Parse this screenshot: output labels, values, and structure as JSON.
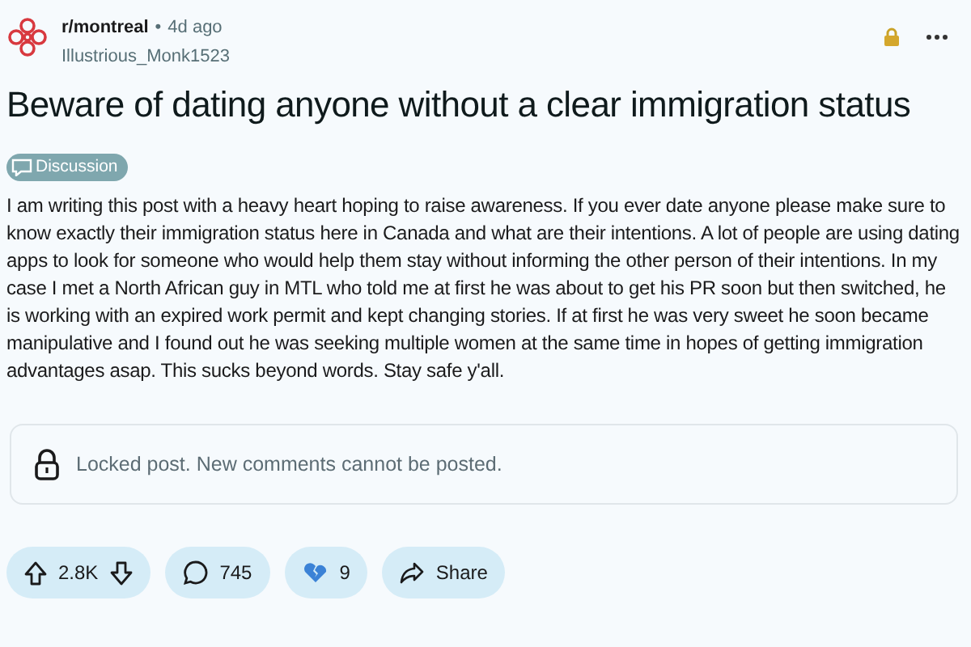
{
  "post": {
    "subreddit": "r/montreal",
    "separator": "•",
    "age": "4d ago",
    "author": "Illustrious_Monk1523",
    "locked": true,
    "title": "Beware of dating anyone without a clear immigration status",
    "flair": "Discussion",
    "body": "I am writing this post with a heavy heart hoping to raise awareness. If you ever date anyone please make sure to know exactly their immigration status here in Canada and what are their intentions. A lot of people are using dating apps to look for someone who would help them stay without informing the other person of their intentions. In my case I met a North African guy in MTL who told me at first he was about to get his PR soon but then switched, he is working with an expired work permit and kept changing stories. If at first he was very sweet he soon became manipulative and I found out he was seeking multiple women at the same time in hopes of getting immigration advantages asap. This sucks beyond words. Stay safe y'all."
  },
  "locked_notice": "Locked post. New comments cannot be posted.",
  "actions": [
    {
      "kind": "vote",
      "text": "2.8K"
    },
    {
      "kind": "comments",
      "text": "745"
    },
    {
      "kind": "award",
      "text": "9"
    },
    {
      "kind": "share",
      "text": "Share"
    }
  ]
}
